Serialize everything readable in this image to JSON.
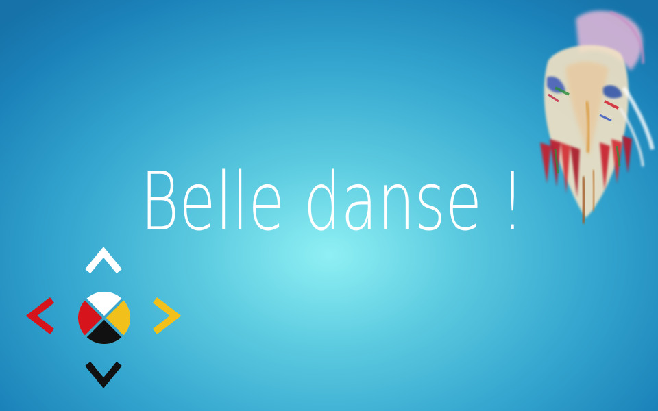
{
  "screen": {
    "message": "Belle danse !"
  },
  "controls": {
    "up": {
      "icon": "chevron-up-icon",
      "color": "#ffffff"
    },
    "down": {
      "icon": "chevron-down-icon",
      "color": "#111111"
    },
    "left": {
      "icon": "chevron-left-icon",
      "color": "#d6141c"
    },
    "right": {
      "icon": "chevron-right-icon",
      "color": "#f2c01a"
    },
    "center": {
      "icon": "medicine-wheel-icon",
      "colors": [
        "#ffffff",
        "#f2c01a",
        "#111111",
        "#d6141c"
      ]
    }
  },
  "colors": {
    "background_center": "#8ff0f4",
    "background_edge": "#1672a8",
    "message_text": "#ffffff"
  }
}
